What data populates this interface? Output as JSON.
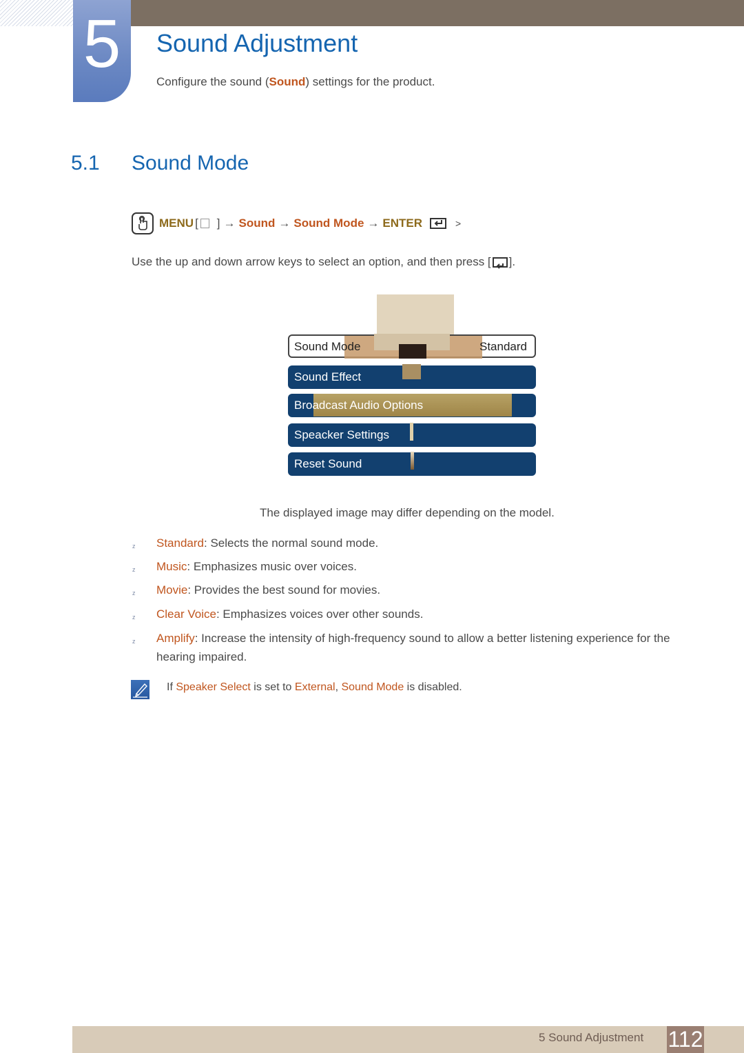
{
  "header": {
    "chapter_number": "5",
    "title": "Sound Adjustment",
    "subtitle_pre": "Configure the sound (",
    "subtitle_highlight": "Sound",
    "subtitle_post": ") settings for the product."
  },
  "section": {
    "number": "5.1",
    "title": "Sound Mode"
  },
  "menu_path": {
    "menu_label": "MENU",
    "bracket_open": "[",
    "bracket_close": "]",
    "arrow": "→",
    "step1": "Sound",
    "step2": "Sound Mode",
    "enter_label": "ENTER",
    "trailing": ">"
  },
  "instruction": {
    "text": "Use the up and down arrow keys to select an option, and then press [",
    "text_end": "]."
  },
  "osd_menu": {
    "items": [
      {
        "label": "Sound Mode",
        "value": "Standard",
        "selected": true
      },
      {
        "label": "Sound Effect"
      },
      {
        "label": "Broadcast Audio Options"
      },
      {
        "label": "Speacker Settings"
      },
      {
        "label": "Reset Sound"
      }
    ]
  },
  "caption": "The displayed image may differ depending on the model.",
  "options": [
    {
      "term": "Standard",
      "desc": ": Selects the normal sound mode."
    },
    {
      "term": "Music",
      "desc": ": Emphasizes music over voices."
    },
    {
      "term": "Movie",
      "desc": ": Provides the best sound for movies."
    },
    {
      "term": "Clear Voice",
      "desc": ": Emphasizes voices over other sounds."
    },
    {
      "term": "Amplify",
      "desc": ": Increase the intensity of high-frequency sound to allow a better listening experience for the hearing impaired."
    }
  ],
  "bullet_glyph": "z",
  "note": {
    "pre": "If ",
    "term1": "Speaker Select",
    "mid": " is set to ",
    "term2": "External",
    "sep": ", ",
    "term3": "Sound Mode",
    "post": " is disabled."
  },
  "footer": {
    "section_label": "5 Sound Adjustment",
    "page_number": "112"
  },
  "colors": {
    "title_blue": "#1565b0",
    "highlight_orange": "#c0561f",
    "menu_gold": "#8d6a1c",
    "osd_blue": "#12406f",
    "topbar_brown": "#7c6f62",
    "footer_beige": "#d8cbb8"
  }
}
